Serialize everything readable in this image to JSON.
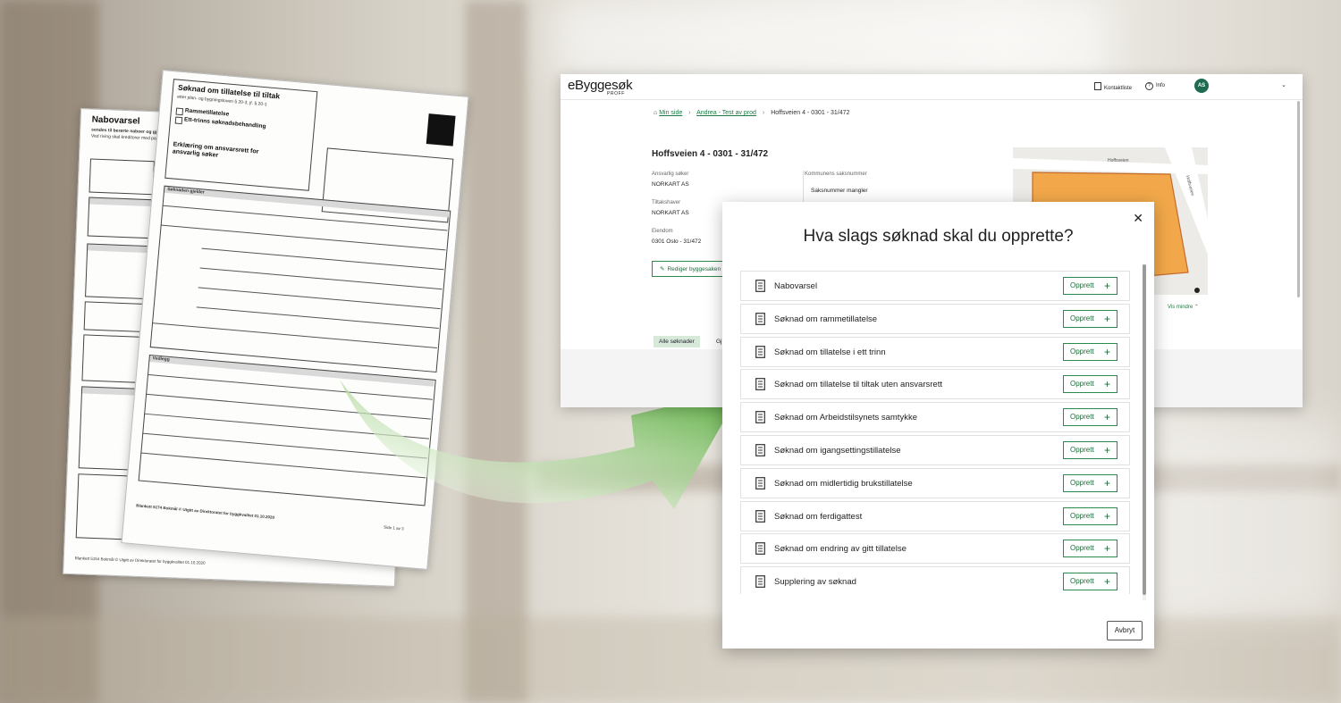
{
  "paper_back": {
    "title": "Nabovarsel",
    "subtitle": "sendes til berørte naboer og gjenboere",
    "line1": "Ved riving skal kreditorer med pant",
    "footer": "Blankett 5154 Bokmål   © Utgitt av Direktoratet for byggkvalitet   01.10.2020"
  },
  "paper_front": {
    "title": "Søknad om tillatelse til tiltak",
    "law": "etter plan- og bygningsloven § 20-3, jf. § 20-1",
    "opt1": "Rammetillatelse",
    "opt2": "Ett-trinns søknadsbehandling",
    "heading2": "Erklæring om ansvarsrett for ansvarlig søker",
    "section1": "Søknaden gjelder",
    "section2": "Vedlegg",
    "footer": "Blankett 5174 Bokmål   © Utgitt av Direktoratet for byggkvalitet   01.10.2020",
    "page": "Side 1 av 3"
  },
  "app": {
    "logo": "eByggesøk",
    "logo_sub": "PROFF",
    "nav_contacts": "Kontaktliste",
    "nav_info": "Info",
    "avatar": "AS",
    "breadcrumb": {
      "home": "Min side",
      "project": "Andrea - Test av prod",
      "current": "Hoffsveien 4 - 0301 - 31/472"
    },
    "property_title": "Hoffsveien 4 - 0301 - 31/472",
    "applicant_label": "Ansvarlig søker",
    "applicant_value": "NORKART AS",
    "owner_label": "Tiltakshaver",
    "owner_value": "NORKART AS",
    "property_label": "Eiendom",
    "property_value": "0301 Oslo - 31/472",
    "case_label": "Kommunens saksnummer",
    "case_value": "Saksnummer mangler",
    "edit_button": "Rediger byggesaken",
    "map_road": "Hoffsveien",
    "map_road2": "Hoffsveien",
    "show_less": "Vis mindre",
    "tab_all": "Alle søknader",
    "tab_other": "Gj"
  },
  "modal": {
    "title": "Hva slags søknad skal du opprette?",
    "create_label": "Opprett",
    "cancel": "Avbryt",
    "items": [
      "Nabovarsel",
      "Søknad om rammetillatelse",
      "Søknad om tillatelse i ett trinn",
      "Søknad om tillatelse til tiltak uten ansvarsrett",
      "Søknad om Arbeidstilsynets samtykke",
      "Søknad om igangsettingstillatelse",
      "Søknad om midlertidig brukstillatelse",
      "Søknad om ferdigattest",
      "Søknad om endring av gitt tillatelse",
      "Supplering av søknad"
    ]
  },
  "colors": {
    "accent_green": "#2a8a4a",
    "arrow_green": "#4fa832",
    "avatar_bg": "#1e6b4f",
    "map_orange": "#f2a84a"
  }
}
